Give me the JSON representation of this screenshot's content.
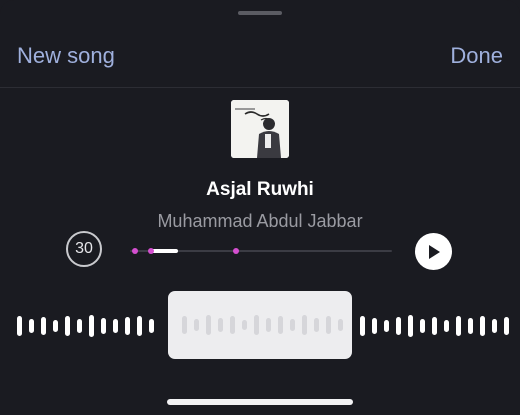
{
  "nav": {
    "new_song_label": "New song",
    "done_label": "Done"
  },
  "song": {
    "title": "Asjal Ruwhi",
    "artist": "Muhammad Abdul Jabbar"
  },
  "player": {
    "skip_back_label": "30"
  },
  "colors": {
    "accent_link": "#9fb0dd",
    "marker": "#d44fd0",
    "background": "#1a1b21"
  },
  "icons": {
    "play": "play-icon",
    "grabber": "sheet-grabber"
  }
}
